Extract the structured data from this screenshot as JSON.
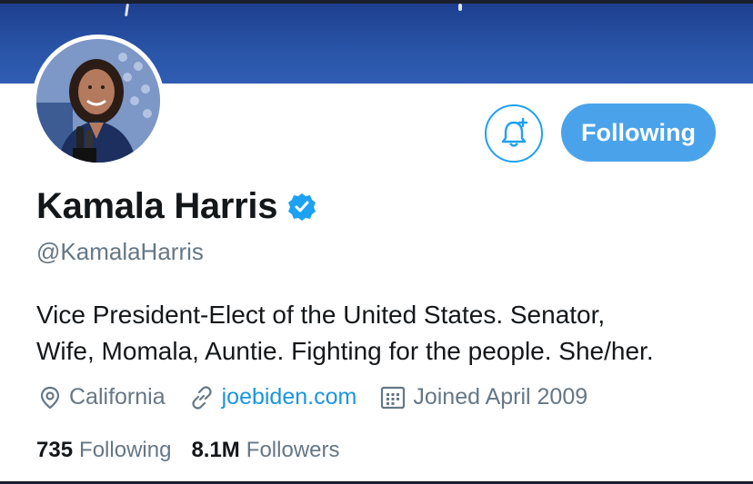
{
  "profile": {
    "name": "Kamala Harris",
    "handle": "@KamalaHarris",
    "bio_line1": "Vice President-Elect of the United States. Senator,",
    "bio_line2": "Wife, Momala, Auntie. Fighting for the people. She/her.",
    "location": "California",
    "website": "joebiden.com",
    "joined": "Joined April 2009",
    "verified": true
  },
  "actions": {
    "following_button": "Following",
    "notification_icon": "bell-plus-icon"
  },
  "stats": {
    "following_count": "735",
    "following_label": "Following",
    "followers_count": "8.1M",
    "followers_label": "Followers"
  },
  "colors": {
    "accent": "#1da1f2",
    "button_fill": "#4aa3ea",
    "link": "#1b95e0",
    "secondary_text": "#657786",
    "primary_text": "#14171a",
    "banner": "#2a55a8"
  }
}
